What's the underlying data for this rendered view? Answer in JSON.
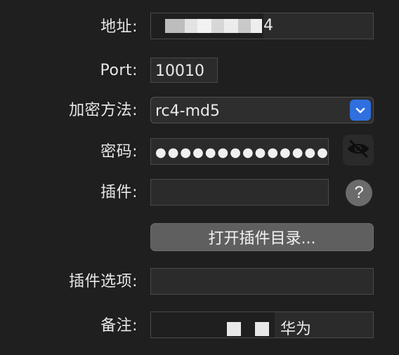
{
  "form": {
    "address": {
      "label": "地址:",
      "value_tail": "4"
    },
    "port": {
      "label": "Port:",
      "value": "10010"
    },
    "encryption": {
      "label": "加密方法:",
      "value": "rc4-md5"
    },
    "password": {
      "label": "密码:",
      "value": "●●●●●●●●●●●●●●●●●"
    },
    "plugin": {
      "label": "插件:",
      "value": ""
    },
    "open_plugin_dir": {
      "label": "打开插件目录..."
    },
    "plugin_options": {
      "label": "插件选项:",
      "value": ""
    },
    "remark": {
      "label": "备注:",
      "value_tail": "华为"
    },
    "help": {
      "glyph": "?"
    }
  },
  "icons": {
    "encryption_dropdown": "chevron-down-icon",
    "password_visibility": "eye-slash-icon",
    "plugin_help": "question-icon"
  },
  "colors": {
    "background": "#1f1f1f",
    "accent": "#2f6fe0",
    "field_bg": "#2b2b2b",
    "button_bg": "#5f5f5f"
  }
}
